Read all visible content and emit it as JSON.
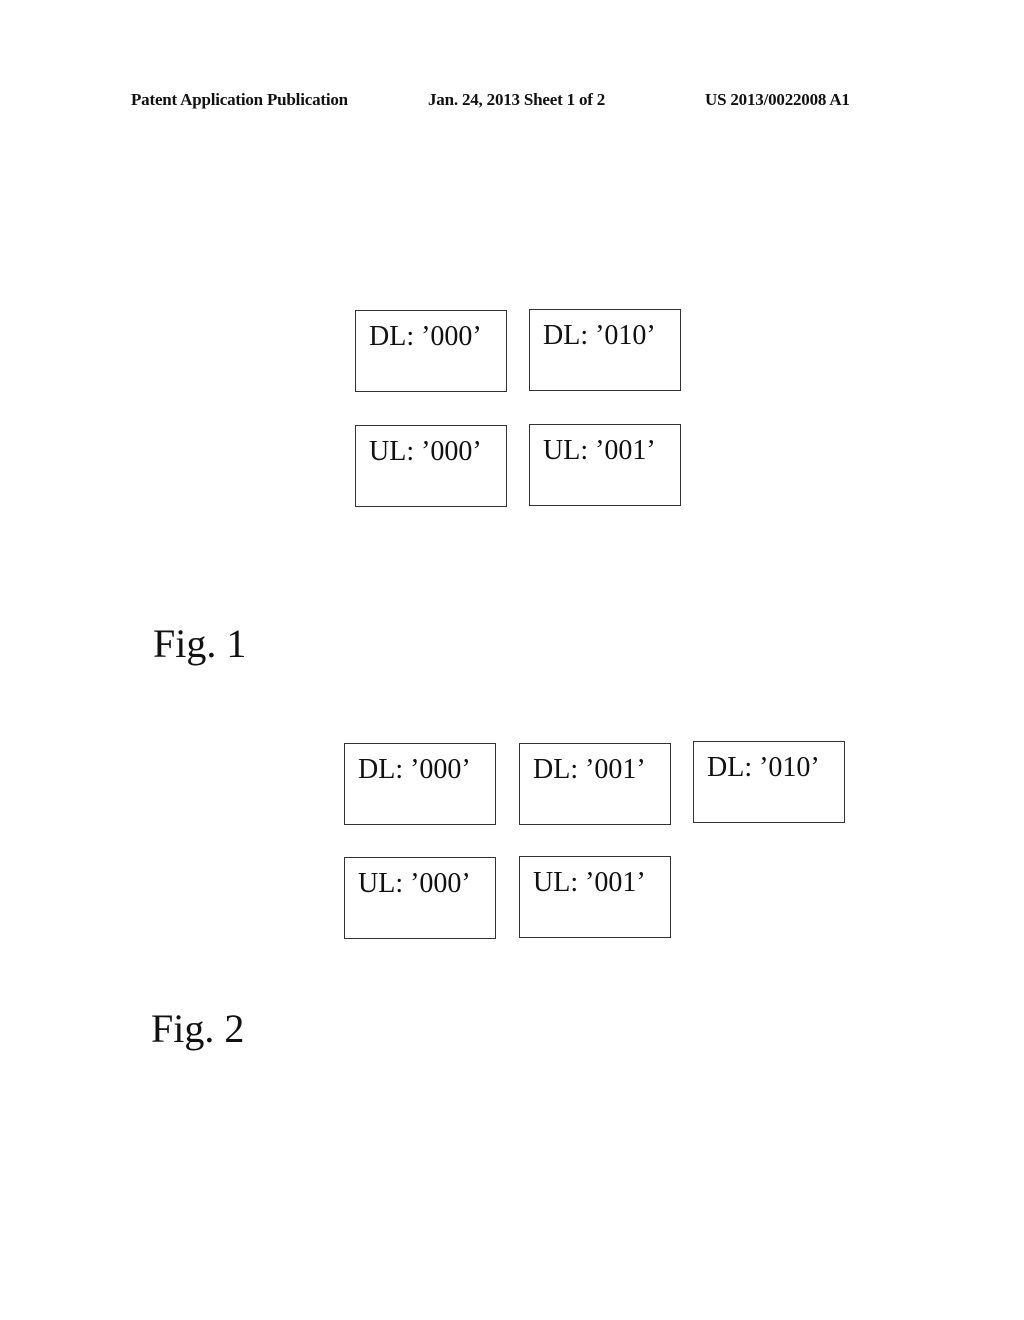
{
  "header": {
    "publication": "Patent Application Publication",
    "date_sheet": "Jan. 24, 2013  Sheet 1 of 2",
    "number": "US 2013/0022008 A1"
  },
  "figures": [
    {
      "label": "Fig. 1",
      "boxes": [
        "DL: ’000’",
        "DL: ’010’",
        "UL: ’000’",
        "UL: ’001’"
      ]
    },
    {
      "label": "Fig. 2",
      "boxes": [
        "DL: ’000’",
        "DL: ’001’",
        "DL: ’010’",
        "UL: ’000’",
        "UL: ’001’"
      ]
    }
  ]
}
